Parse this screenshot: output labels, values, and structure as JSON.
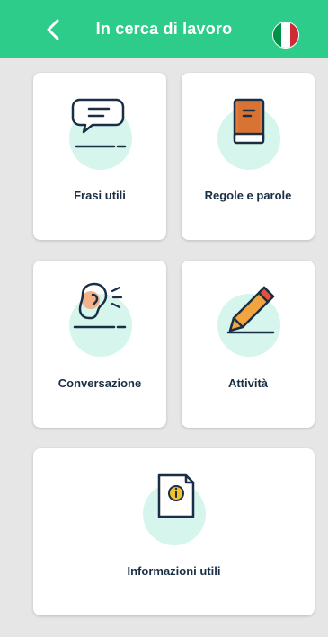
{
  "header": {
    "title": "In cerca di lavoro",
    "back_icon": "chevron-left-icon",
    "language_icon": "italian-flag-icon",
    "flag_colors": [
      "#009246",
      "#ffffff",
      "#ce2b37"
    ]
  },
  "theme": {
    "accent": "#2ecc8a",
    "icon_circle": "#d6f5ec",
    "text": "#1a2f45"
  },
  "cards": {
    "frasi": {
      "label": "Frasi utili",
      "icon": "speech-bubble-icon"
    },
    "regole": {
      "label": "Regole e parole",
      "icon": "book-icon"
    },
    "conversazione": {
      "label": "Conversazione",
      "icon": "ear-icon"
    },
    "attivita": {
      "label": "Attività",
      "icon": "pencil-icon"
    },
    "informazioni": {
      "label": "Informazioni utili",
      "icon": "info-document-icon"
    }
  }
}
